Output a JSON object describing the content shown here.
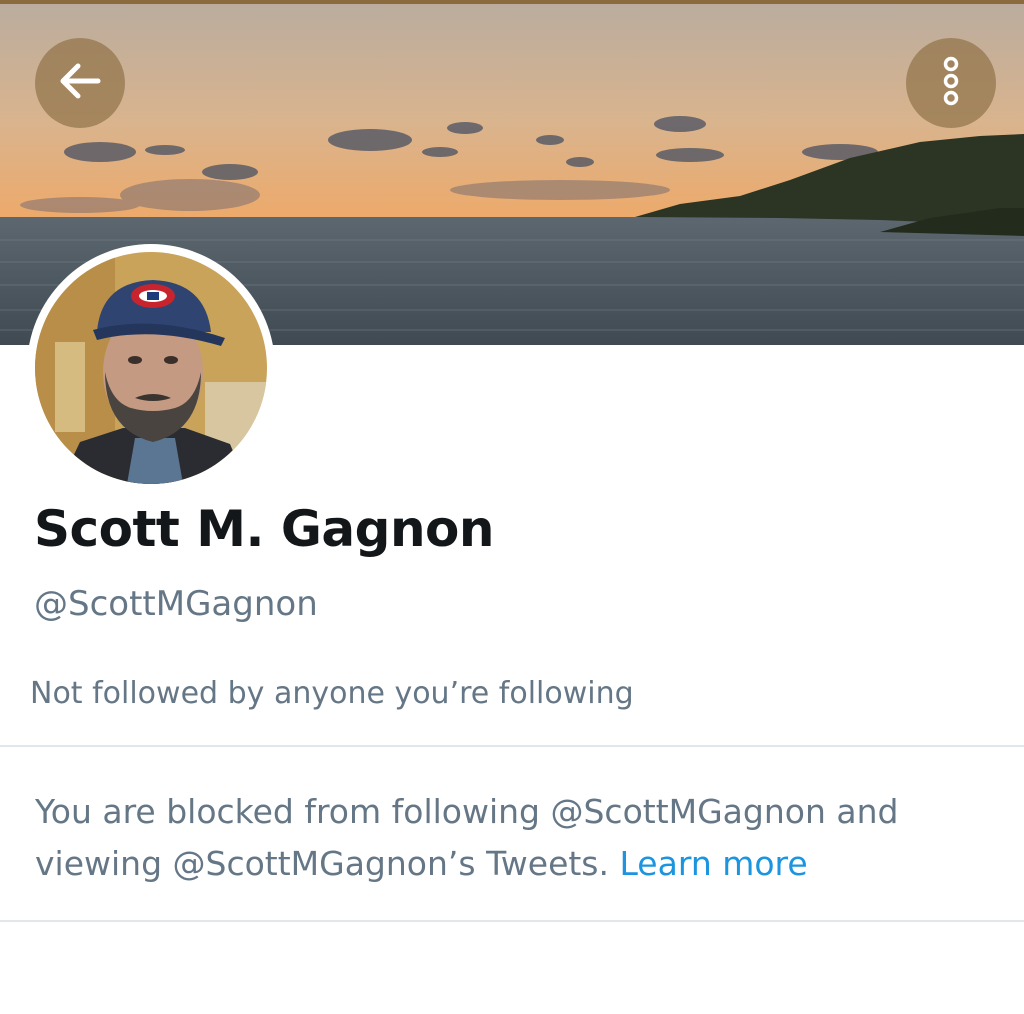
{
  "header": {
    "back_icon": "arrow-left-icon",
    "more_icon": "more-vertical-icon",
    "banner_colors": {
      "sky_top": "#b8a898",
      "sky_horizon": "#f0a060",
      "sea": "#4a5660",
      "land": "#2a3320"
    }
  },
  "profile": {
    "display_name": "Scott M. Gagnon",
    "handle": "@ScottMGagnon",
    "followers_you_know": "Not followed by anyone you’re following"
  },
  "blocked": {
    "message": "You are blocked from following @ScottMGagnon and viewing @ScottMGagnon’s Tweets.",
    "learn_more": "Learn more"
  },
  "colors": {
    "primary_text": "#14171a",
    "secondary_text": "#657786",
    "link": "#1b95e0",
    "divider": "#e1e8ed"
  }
}
